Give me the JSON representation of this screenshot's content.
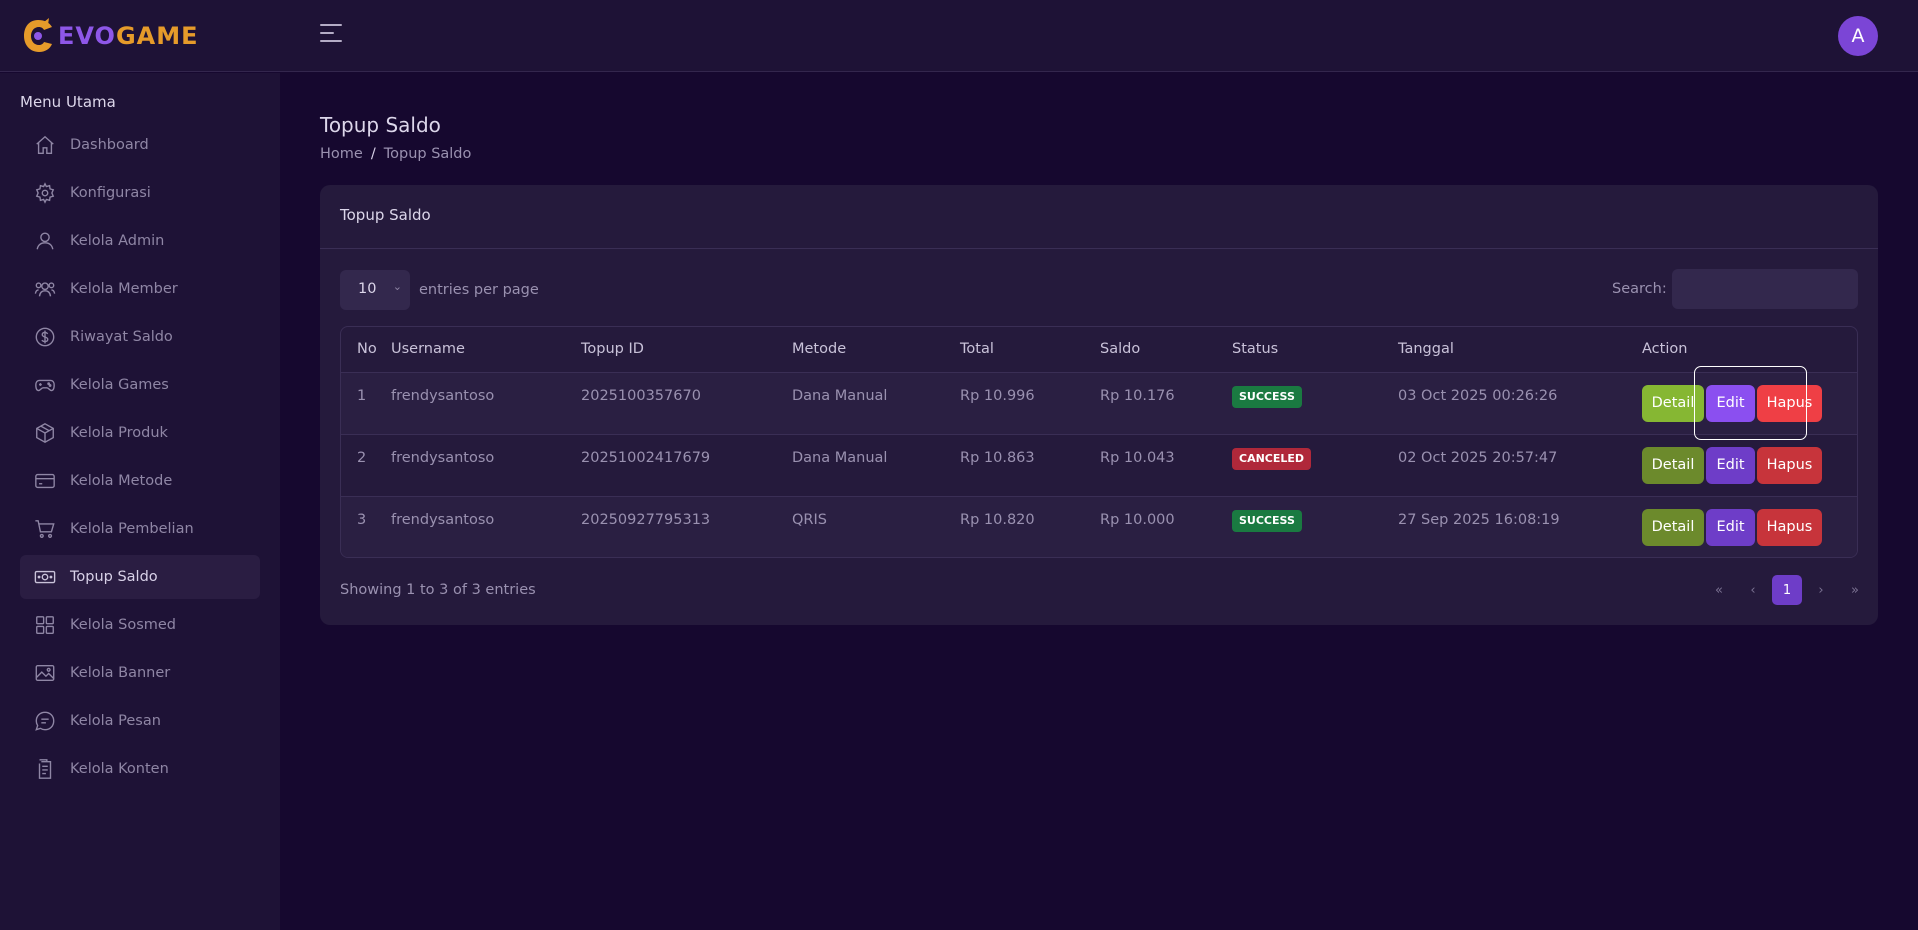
{
  "brand": {
    "part1": "EVO",
    "part2": "GAME"
  },
  "user": {
    "avatar_initial": "A"
  },
  "sidebar": {
    "title": "Menu Utama",
    "items": [
      {
        "label": "Dashboard",
        "icon": "home-icon"
      },
      {
        "label": "Konfigurasi",
        "icon": "gear-icon"
      },
      {
        "label": "Kelola Admin",
        "icon": "user-icon"
      },
      {
        "label": "Kelola Member",
        "icon": "users-icon"
      },
      {
        "label": "Riwayat Saldo",
        "icon": "dollar-circle-icon"
      },
      {
        "label": "Kelola Games",
        "icon": "gamepad-icon"
      },
      {
        "label": "Kelola Produk",
        "icon": "box-icon"
      },
      {
        "label": "Kelola Metode",
        "icon": "credit-card-icon"
      },
      {
        "label": "Kelola Pembelian",
        "icon": "cart-icon"
      },
      {
        "label": "Topup Saldo",
        "icon": "banknote-icon",
        "active": true
      },
      {
        "label": "Kelola Sosmed",
        "icon": "grid-icon"
      },
      {
        "label": "Kelola Banner",
        "icon": "image-icon"
      },
      {
        "label": "Kelola Pesan",
        "icon": "message-icon"
      },
      {
        "label": "Kelola Konten",
        "icon": "document-icon"
      }
    ]
  },
  "page": {
    "title": "Topup Saldo",
    "breadcrumb": {
      "home": "Home",
      "sep": "/",
      "current": "Topup Saldo"
    }
  },
  "card": {
    "title": "Topup Saldo",
    "entries": {
      "value": "10",
      "label": "entries per page"
    },
    "search": {
      "label": "Search:",
      "value": ""
    },
    "table": {
      "columns": [
        "No",
        "Username",
        "Topup ID",
        "Metode",
        "Total",
        "Saldo",
        "Status",
        "Tanggal",
        "Action"
      ],
      "rows": [
        {
          "no": "1",
          "username": "frendysantoso",
          "topup_id": "2025100357670",
          "metode": "Dana Manual",
          "total": "Rp 10.996",
          "saldo": "Rp 10.176",
          "status": "SUCCESS",
          "tanggal": "03 Oct 2025 00:26:26"
        },
        {
          "no": "2",
          "username": "frendysantoso",
          "topup_id": "20251002417679",
          "metode": "Dana Manual",
          "total": "Rp 10.863",
          "saldo": "Rp 10.043",
          "status": "CANCELED",
          "tanggal": "02 Oct 2025 20:57:47"
        },
        {
          "no": "3",
          "username": "frendysantoso",
          "topup_id": "20250927795313",
          "metode": "QRIS",
          "total": "Rp 10.820",
          "saldo": "Rp 10.000",
          "status": "SUCCESS",
          "tanggal": "27 Sep 2025 16:08:19"
        }
      ],
      "actions": {
        "detail": "Detail",
        "edit": "Edit",
        "hapus": "Hapus"
      }
    },
    "footer": {
      "info": "Showing 1 to 3 of 3 entries"
    },
    "pagination": {
      "first": "«",
      "prev": "‹",
      "current": "1",
      "next": "›",
      "last": "»"
    }
  },
  "colors": {
    "accent": "#6e3dc8",
    "success": "#1a7a41",
    "danger": "#b0283a",
    "detail": "#6c8a2c"
  }
}
